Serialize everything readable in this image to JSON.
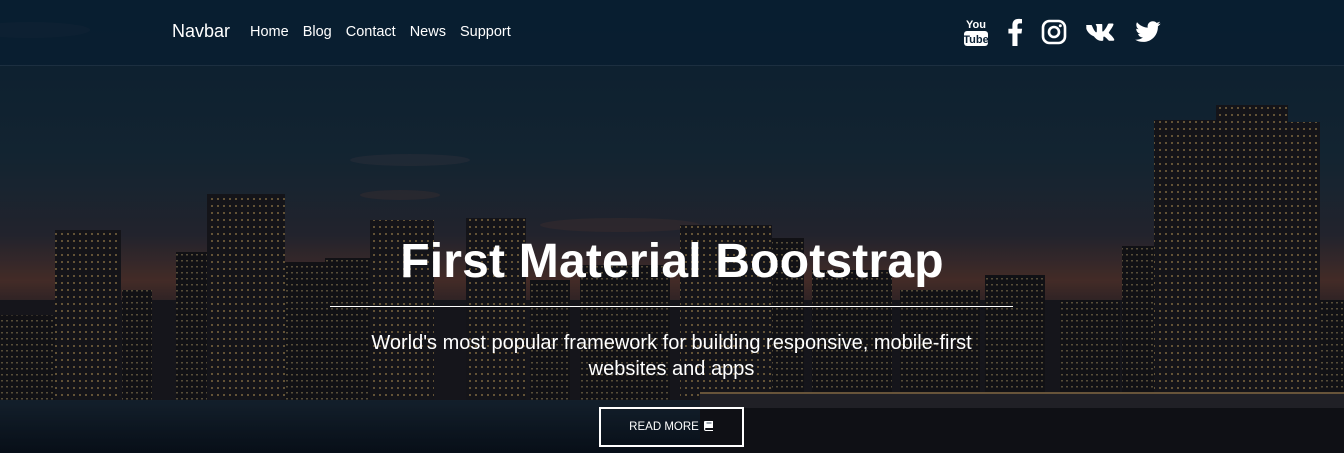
{
  "navbar": {
    "brand": "Navbar",
    "links": [
      "Home",
      "Blog",
      "Contact",
      "News",
      "Support"
    ],
    "social_icons": [
      "youtube-icon",
      "facebook-icon",
      "instagram-icon",
      "vk-icon",
      "twitter-icon"
    ]
  },
  "hero": {
    "title": "First Material Bootstrap",
    "subtitle": "World's most popular framework for building responsive, mobile-first websites and apps",
    "button_label": "READ MORE",
    "button_icon": "book-icon"
  },
  "colors": {
    "text": "#ffffff",
    "navbar_bg": "#0c2236",
    "sky_top": "#0d2a40",
    "sunset": "#5a3a34"
  }
}
